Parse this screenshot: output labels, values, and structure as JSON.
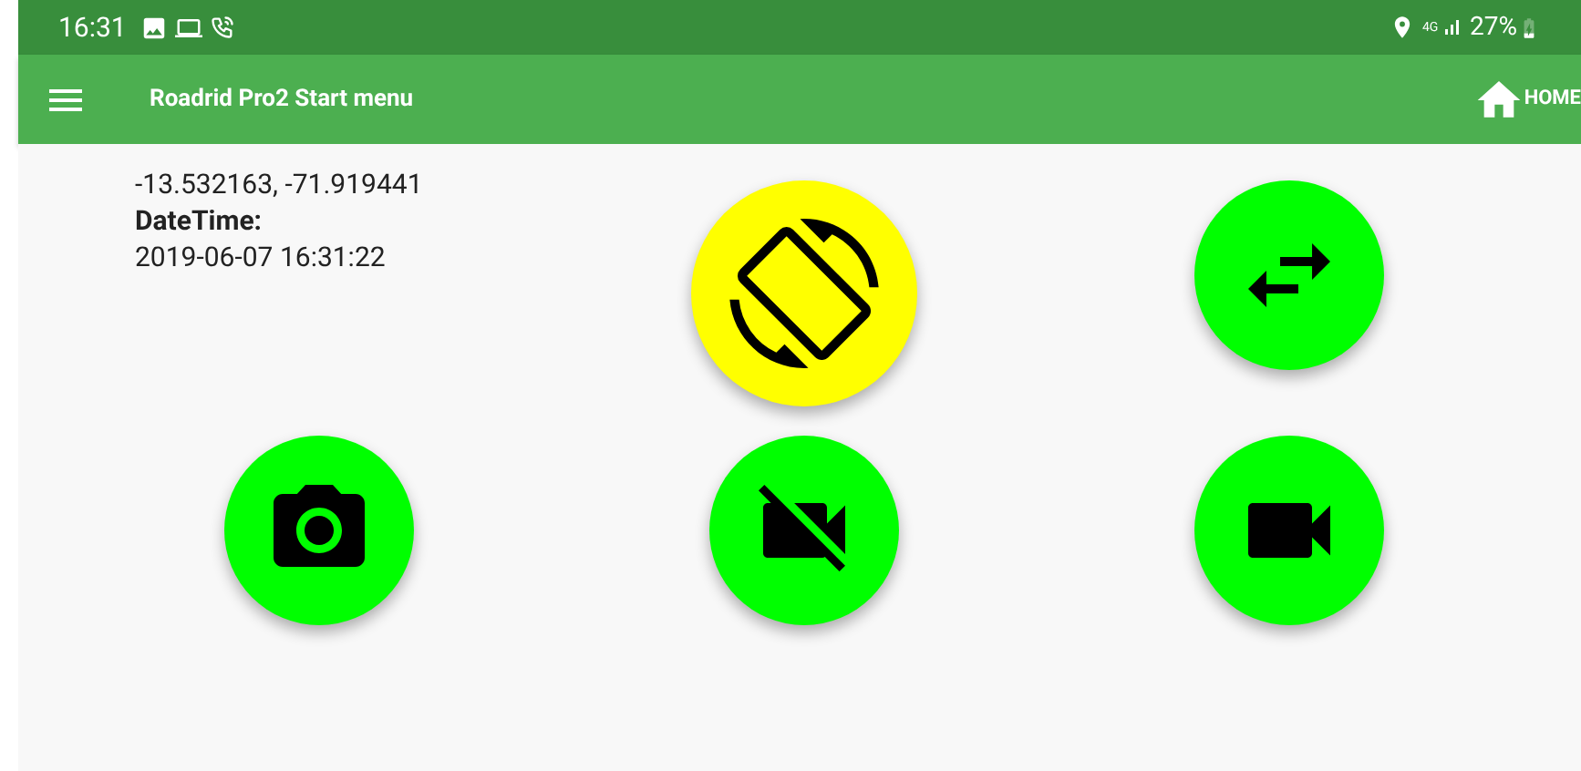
{
  "status_bar": {
    "time": "16:31",
    "network": "4G",
    "battery": "27%"
  },
  "app_bar": {
    "title": "Roadrid Pro2 Start menu",
    "home": "HOME"
  },
  "info": {
    "coordinates": "-13.532163, -71.919441",
    "datetime_label": "DateTime:",
    "datetime": "2019-06-07 16:31:22"
  },
  "buttons": [
    {
      "kind": "rotate",
      "color": "#ffff00"
    },
    {
      "kind": "swap",
      "color": "#00ff00"
    },
    {
      "kind": "camera",
      "color": "#00ff00"
    },
    {
      "kind": "video-off",
      "color": "#00ff00"
    },
    {
      "kind": "video",
      "color": "#00ff00"
    }
  ]
}
